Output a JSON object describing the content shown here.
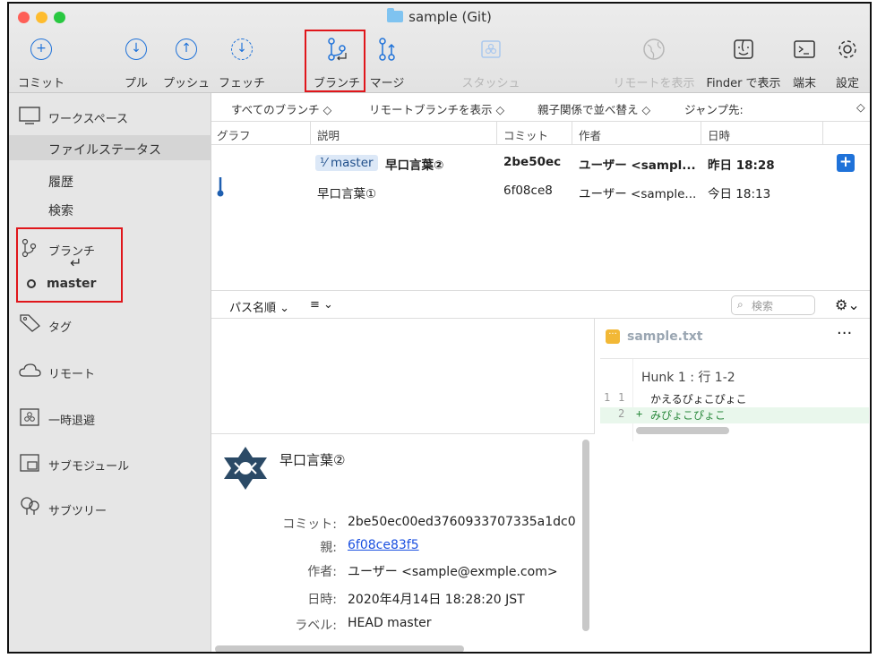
{
  "window": {
    "title": "sample (Git)"
  },
  "toolbar": {
    "commit": "コミット",
    "pull": "プル",
    "push": "プッシュ",
    "fetch": "フェッチ",
    "branch": "ブランチ",
    "merge": "マージ",
    "stash": "スタッシュ",
    "show_remote": "リモートを表示",
    "show_finder": "Finder で表示",
    "terminal": "端末",
    "settings": "設定"
  },
  "sidebar": {
    "workspace": "ワークスペース",
    "file_status": "ファイルステータス",
    "history": "履歴",
    "search": "検索",
    "branches": "ブランチ",
    "branch_master": "master",
    "tags": "タグ",
    "remotes": "リモート",
    "stashes": "一時退避",
    "submodules": "サブモジュール",
    "subtrees": "サブツリー"
  },
  "filters": {
    "all_branches": "すべてのブランチ",
    "show_remote_branches": "リモートブランチを表示",
    "sort": "親子関係で並べ替え",
    "jump_to": "ジャンプ先:"
  },
  "columns": {
    "graph": "グラフ",
    "description": "説明",
    "commit": "コミット",
    "author": "作者",
    "date": "日時"
  },
  "commits": [
    {
      "branch": "master",
      "description": "早口言葉②",
      "hash": "2be50ec",
      "author": "ユーザー <sampl...",
      "date": "昨日 18:28"
    },
    {
      "branch": "",
      "description": "早口言葉①",
      "hash": "6f08ce8",
      "author": "ユーザー <sample...",
      "date": "今日 18:13"
    }
  ],
  "midbar": {
    "sort_path": "パス名順",
    "search_placeholder": "検索"
  },
  "diff": {
    "filename": "sample.txt",
    "hunk": "Hunk 1 : 行 1-2",
    "lines": [
      {
        "old": "1",
        "new": "1",
        "sign": "",
        "text": "かえるぴょこぴょこ"
      },
      {
        "old": "",
        "new": "2",
        "sign": "+",
        "text": "みぴょこぴょこ"
      }
    ]
  },
  "detail": {
    "subject": "早口言葉②",
    "commit_label": "コミット:",
    "commit_value": "2be50ec00ed3760933707335a1dc0",
    "parent_label": "親:",
    "parent_value": "6f08ce83f5",
    "author_label": "作者:",
    "author_value": "ユーザー <sample@exmple.com>",
    "date_label": "日時:",
    "date_value": "2020年4月14日 18:28:20 JST",
    "labels_label": "ラベル:",
    "labels_value": "HEAD master"
  },
  "colors": {
    "accent": "#1f72d9",
    "highlight_box": "#e0161b",
    "added_line_bg": "#e9f7ec"
  }
}
